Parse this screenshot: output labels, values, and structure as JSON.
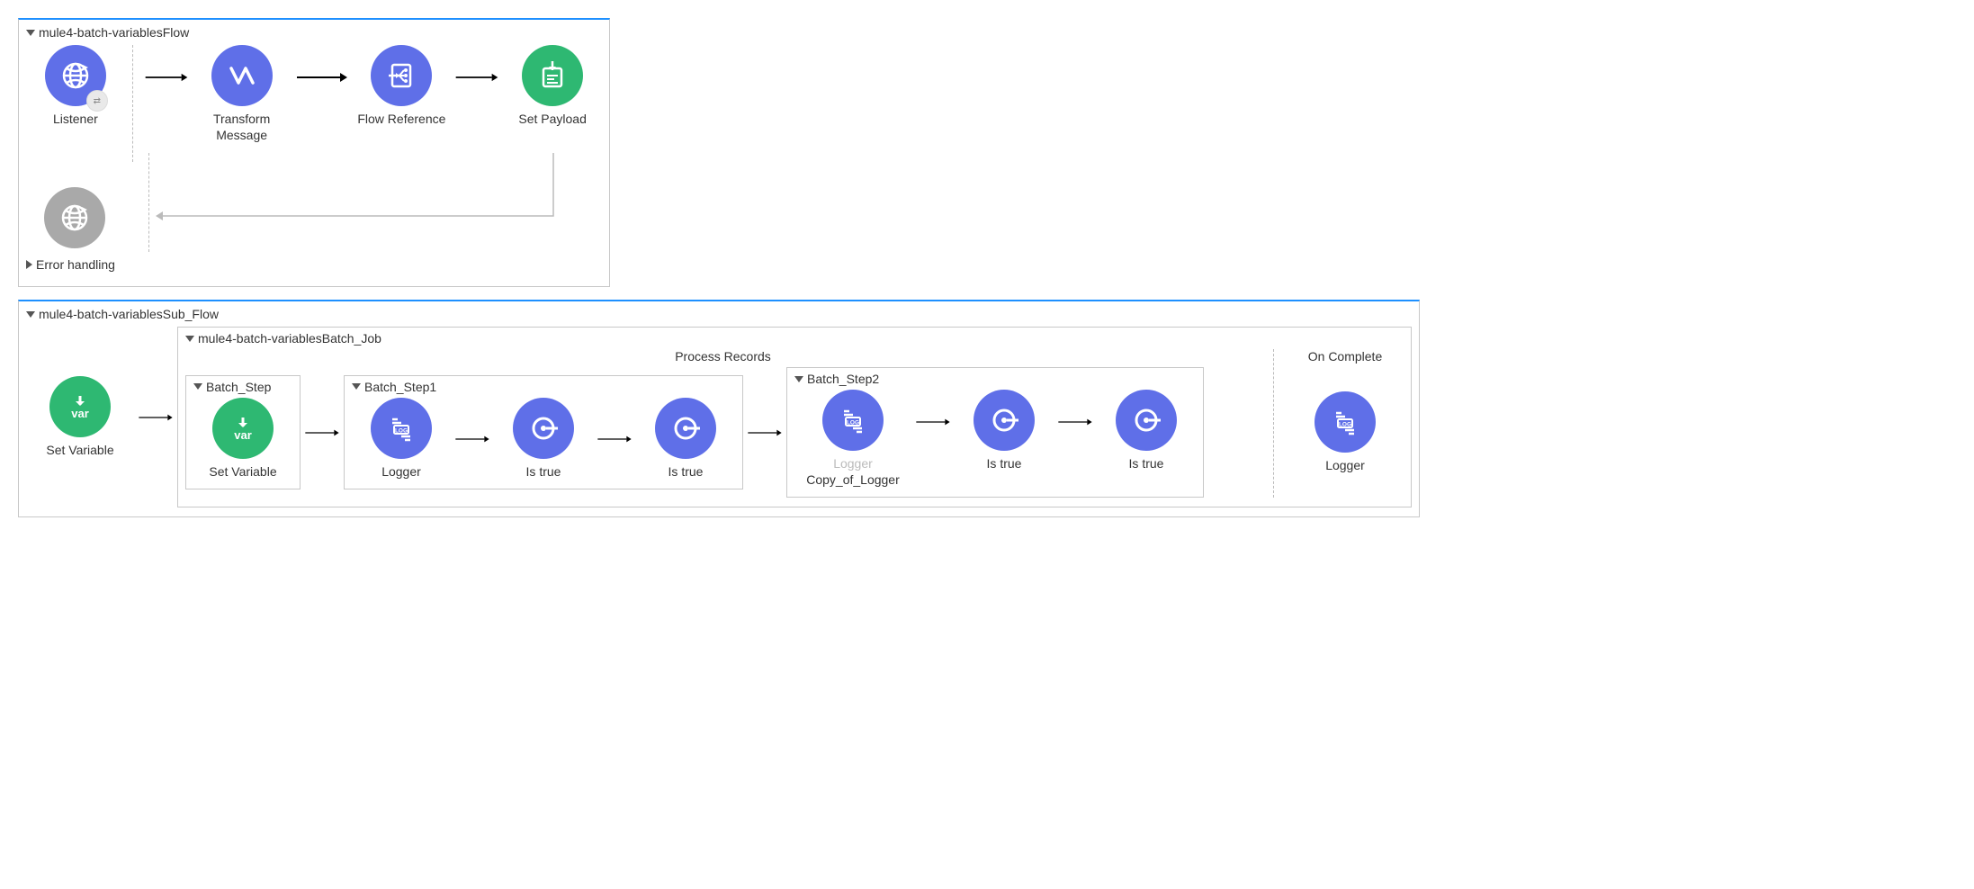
{
  "flow1": {
    "title": "mule4-batch-variablesFlow",
    "nodes": {
      "listener": "Listener",
      "transform1": "Transform",
      "transform2": "Message",
      "flowref": "Flow Reference",
      "setpayload": "Set Payload"
    },
    "error_label": "Error handling"
  },
  "flow2": {
    "title": "mule4-batch-variablesSub_Flow",
    "setvar": "Set Variable",
    "batch_job": {
      "title": "mule4-batch-variablesBatch_Job",
      "process_label": "Process Records",
      "complete_label": "On Complete",
      "step0": {
        "title": "Batch_Step",
        "setvar": "Set Variable"
      },
      "step1": {
        "title": "Batch_Step1",
        "logger": "Logger",
        "istrue1": "Is true",
        "istrue2": "Is true"
      },
      "step2": {
        "title": "Batch_Step2",
        "logger": "Logger",
        "logger_sub": "Copy_of_Logger",
        "istrue1": "Is true",
        "istrue2": "Is true"
      },
      "complete_logger": "Logger"
    }
  }
}
